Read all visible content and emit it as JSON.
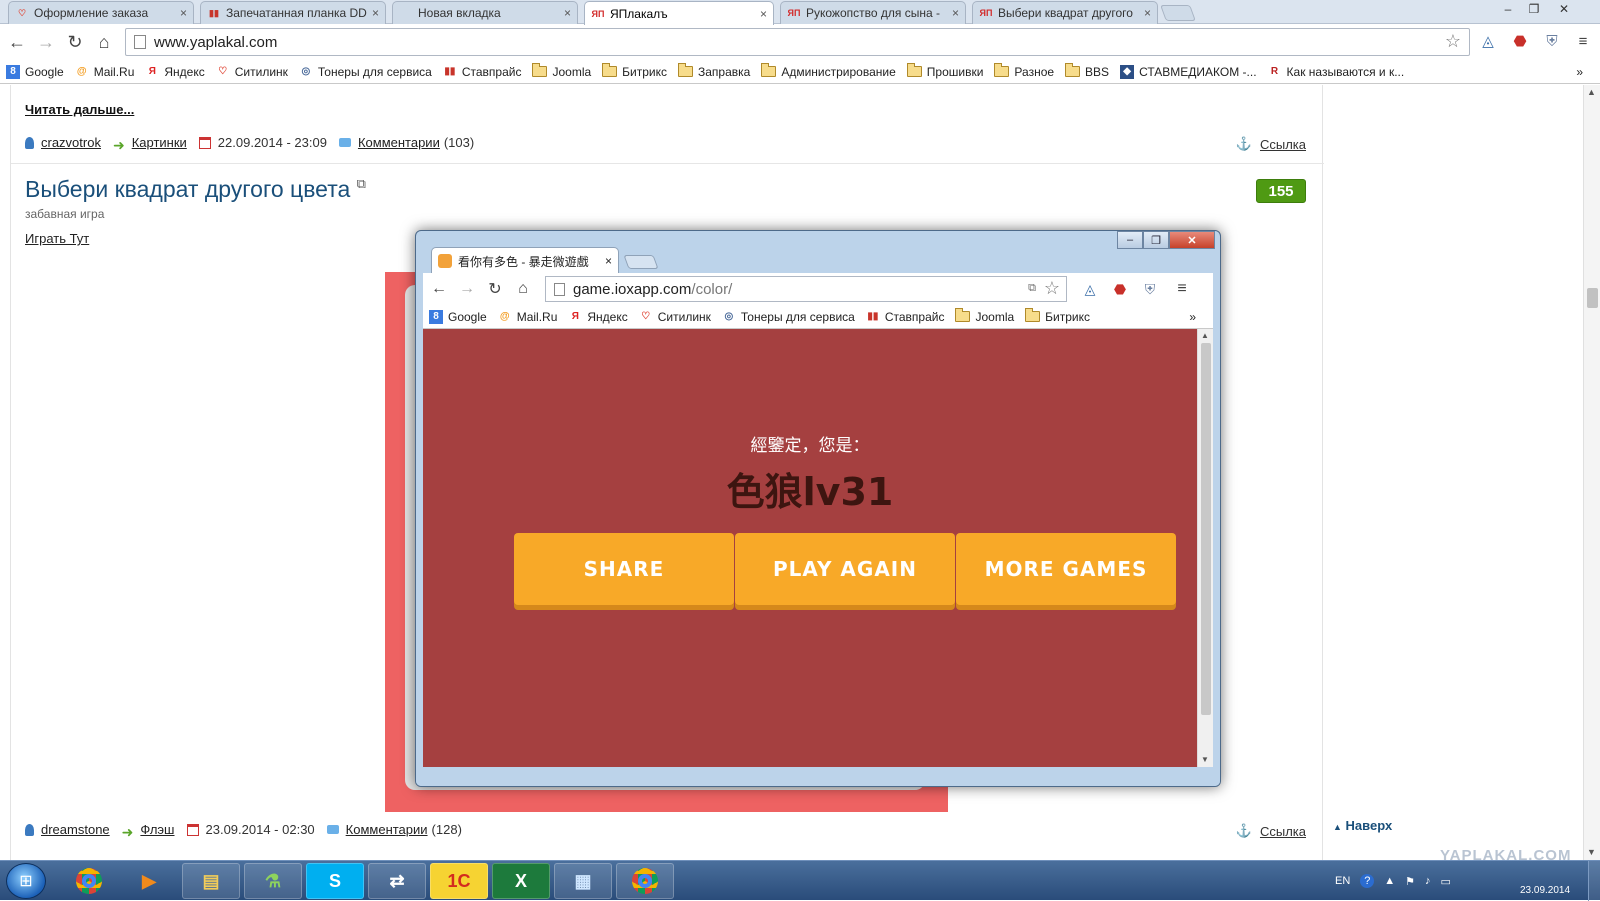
{
  "browser": {
    "tabs": [
      {
        "title": "Оформление заказа",
        "icon": "heart-icon",
        "color": "#e04a3a"
      },
      {
        "title": "Запечатанная планка DD",
        "icon": "chart-icon",
        "color": "#c8342a"
      },
      {
        "title": "Новая вкладка",
        "icon": "blank-icon",
        "color": "#ffffff"
      },
      {
        "title": "ЯПлакалъ",
        "icon": "yp-icon",
        "color": "#d22b2b"
      },
      {
        "title": "Рукожопство для сына -",
        "icon": "yp-icon",
        "color": "#d22b2b"
      },
      {
        "title": "Выбери квадрат другого",
        "icon": "yp-icon",
        "color": "#d22b2b"
      }
    ],
    "active_tab": 3,
    "tab_close": "×",
    "url": "www.yaplakal.com",
    "bookmarks": [
      {
        "label": "Google",
        "icon": "google-icon"
      },
      {
        "label": "Mail.Ru",
        "icon": "mailru-icon"
      },
      {
        "label": "Яндекс",
        "icon": "yandex-icon"
      },
      {
        "label": "Ситилинк",
        "icon": "citilink-icon"
      },
      {
        "label": "Тонеры для сервиса",
        "icon": "toner-icon"
      },
      {
        "label": "Ставпрайс",
        "icon": "stavprice-icon"
      },
      {
        "label": "Joomla",
        "icon": "folder-icon"
      },
      {
        "label": "Битрикс",
        "icon": "folder-icon"
      },
      {
        "label": "Заправка",
        "icon": "folder-icon"
      },
      {
        "label": "Администрирование",
        "icon": "folder-icon"
      },
      {
        "label": "Прошивки",
        "icon": "folder-icon"
      },
      {
        "label": "Разное",
        "icon": "folder-icon"
      },
      {
        "label": "BBS",
        "icon": "folder-icon"
      },
      {
        "label": "СТАВМЕДИАКОМ -...",
        "icon": "stavmedia-icon"
      },
      {
        "label": "Как называются и к...",
        "icon": "search-icon"
      }
    ],
    "bookmarks_more": "»"
  },
  "page": {
    "read_more": "Читать дальше...",
    "post1": {
      "author": "crazvotrok",
      "category": "Картинки",
      "date": "22.09.2014 - 23:09",
      "comments_label": "Комментарии",
      "comments_count": "(103)"
    },
    "link_label": "Ссылка",
    "title": "Выбери квадрат другого цвета",
    "subtitle": "забавная игра",
    "play_link": "Играть Тут",
    "score": "155",
    "post2": {
      "author": "dreamstone",
      "category": "Флэш",
      "date": "23.09.2014 - 02:30",
      "comments_label": "Комментарии",
      "comments_count": "(128)"
    },
    "back_to_top": "Наверх",
    "watermark": "YAPLAKAL.COM"
  },
  "popup": {
    "tab_title": "看你有多色 - 暴走微遊戲",
    "url_host": "game.ioxapp.com",
    "url_path": "/color/",
    "bookmarks": [
      "Google",
      "Mail.Ru",
      "Яндекс",
      "Ситилинк",
      "Тонеры для сервиса",
      "Ставпрайс",
      "Joomla",
      "Битрикс"
    ],
    "result_label": "經鑒定，您是：",
    "result_rank": "色狼lv31",
    "buttons": {
      "share": "SHARE",
      "play_again": "PLAY AGAIN",
      "more_games": "MORE GAMES"
    },
    "game_bg_color": "#a54040",
    "button_color": "#f8a928"
  },
  "taskbar": {
    "lang": "EN",
    "clock_date": "23.09.2014"
  }
}
